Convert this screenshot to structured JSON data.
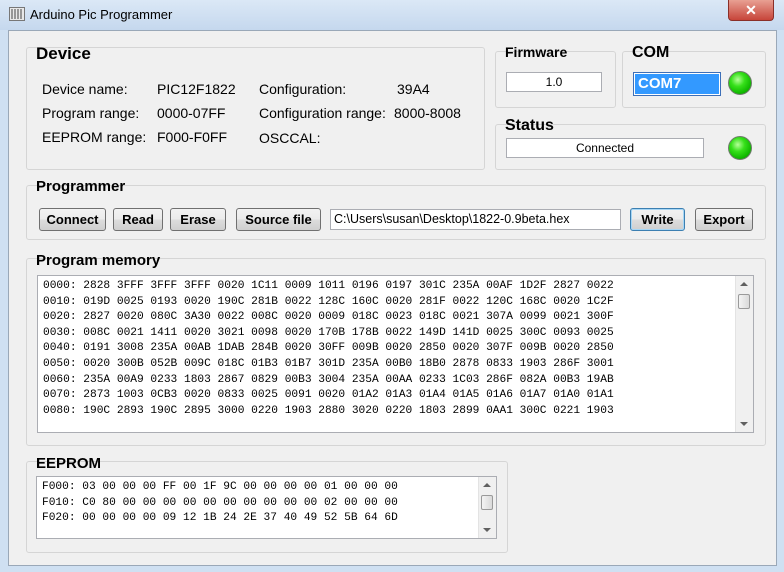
{
  "window": {
    "title": "Arduino Pic Programmer",
    "close_glyph": "✕"
  },
  "device": {
    "heading": "Device",
    "device_name_label": "Device name:",
    "device_name_value": "PIC12F1822",
    "program_range_label": "Program range:",
    "program_range_value": "0000-07FF",
    "eeprom_range_label": "EEPROM range:",
    "eeprom_range_value": "F000-F0FF",
    "configuration_label": "Configuration:",
    "configuration_value": "39A4",
    "configuration_range_label": "Configuration range:",
    "configuration_range_value": "8000-8008",
    "osccal_label": "OSCCAL:"
  },
  "firmware": {
    "heading": "Firmware",
    "value": "1.0"
  },
  "com": {
    "heading": "COM",
    "port": "COM7",
    "led_color": "#22dd22"
  },
  "status": {
    "heading": "Status",
    "value": "Connected",
    "led_color": "#22dd22"
  },
  "programmer": {
    "heading": "Programmer",
    "connect_label": "Connect",
    "read_label": "Read",
    "erase_label": "Erase",
    "source_file_label": "Source file",
    "file_path": "C:\\Users\\susan\\Desktop\\1822-0.9beta.hex",
    "write_label": "Write",
    "export_label": "Export"
  },
  "program_memory": {
    "heading": "Program memory",
    "lines": [
      "0000: 2828 3FFF 3FFF 3FFF 0020 1C11 0009 1011 0196 0197 301C 235A 00AF 1D2F 2827 0022",
      "0010: 019D 0025 0193 0020 190C 281B 0022 128C 160C 0020 281F 0022 120C 168C 0020 1C2F",
      "0020: 2827 0020 080C 3A30 0022 008C 0020 0009 018C 0023 018C 0021 307A 0099 0021 300F",
      "0030: 008C 0021 1411 0020 3021 0098 0020 170B 178B 0022 149D 141D 0025 300C 0093 0025",
      "0040: 0191 3008 235A 00AB 1DAB 284B 0020 30FF 009B 0020 2850 0020 307F 009B 0020 2850",
      "0050: 0020 300B 052B 009C 018C 01B3 01B7 301D 235A 00B0 18B0 2878 0833 1903 286F 3001",
      "0060: 235A 00A9 0233 1803 2867 0829 00B3 3004 235A 00AA 0233 1C03 286F 082A 00B3 19AB",
      "0070: 2873 1003 0CB3 0020 0833 0025 0091 0020 01A2 01A3 01A4 01A5 01A6 01A7 01A0 01A1",
      "0080: 190C 2893 190C 2895 3000 0220 1903 2880 3020 0220 1803 2899 0AA1 300C 0221 1903"
    ]
  },
  "eeprom": {
    "heading": "EEPROM",
    "lines": [
      "F000: 03 00 00 00 FF 00 1F 9C 00 00 00 00 01 00 00 00",
      "F010: C0 80 00 00 00 00 00 00 00 00 00 00 02 00 00 00",
      "F020: 00 00 00 00 09 12 1B 24 2E 37 40 49 52 5B 64 6D"
    ]
  }
}
